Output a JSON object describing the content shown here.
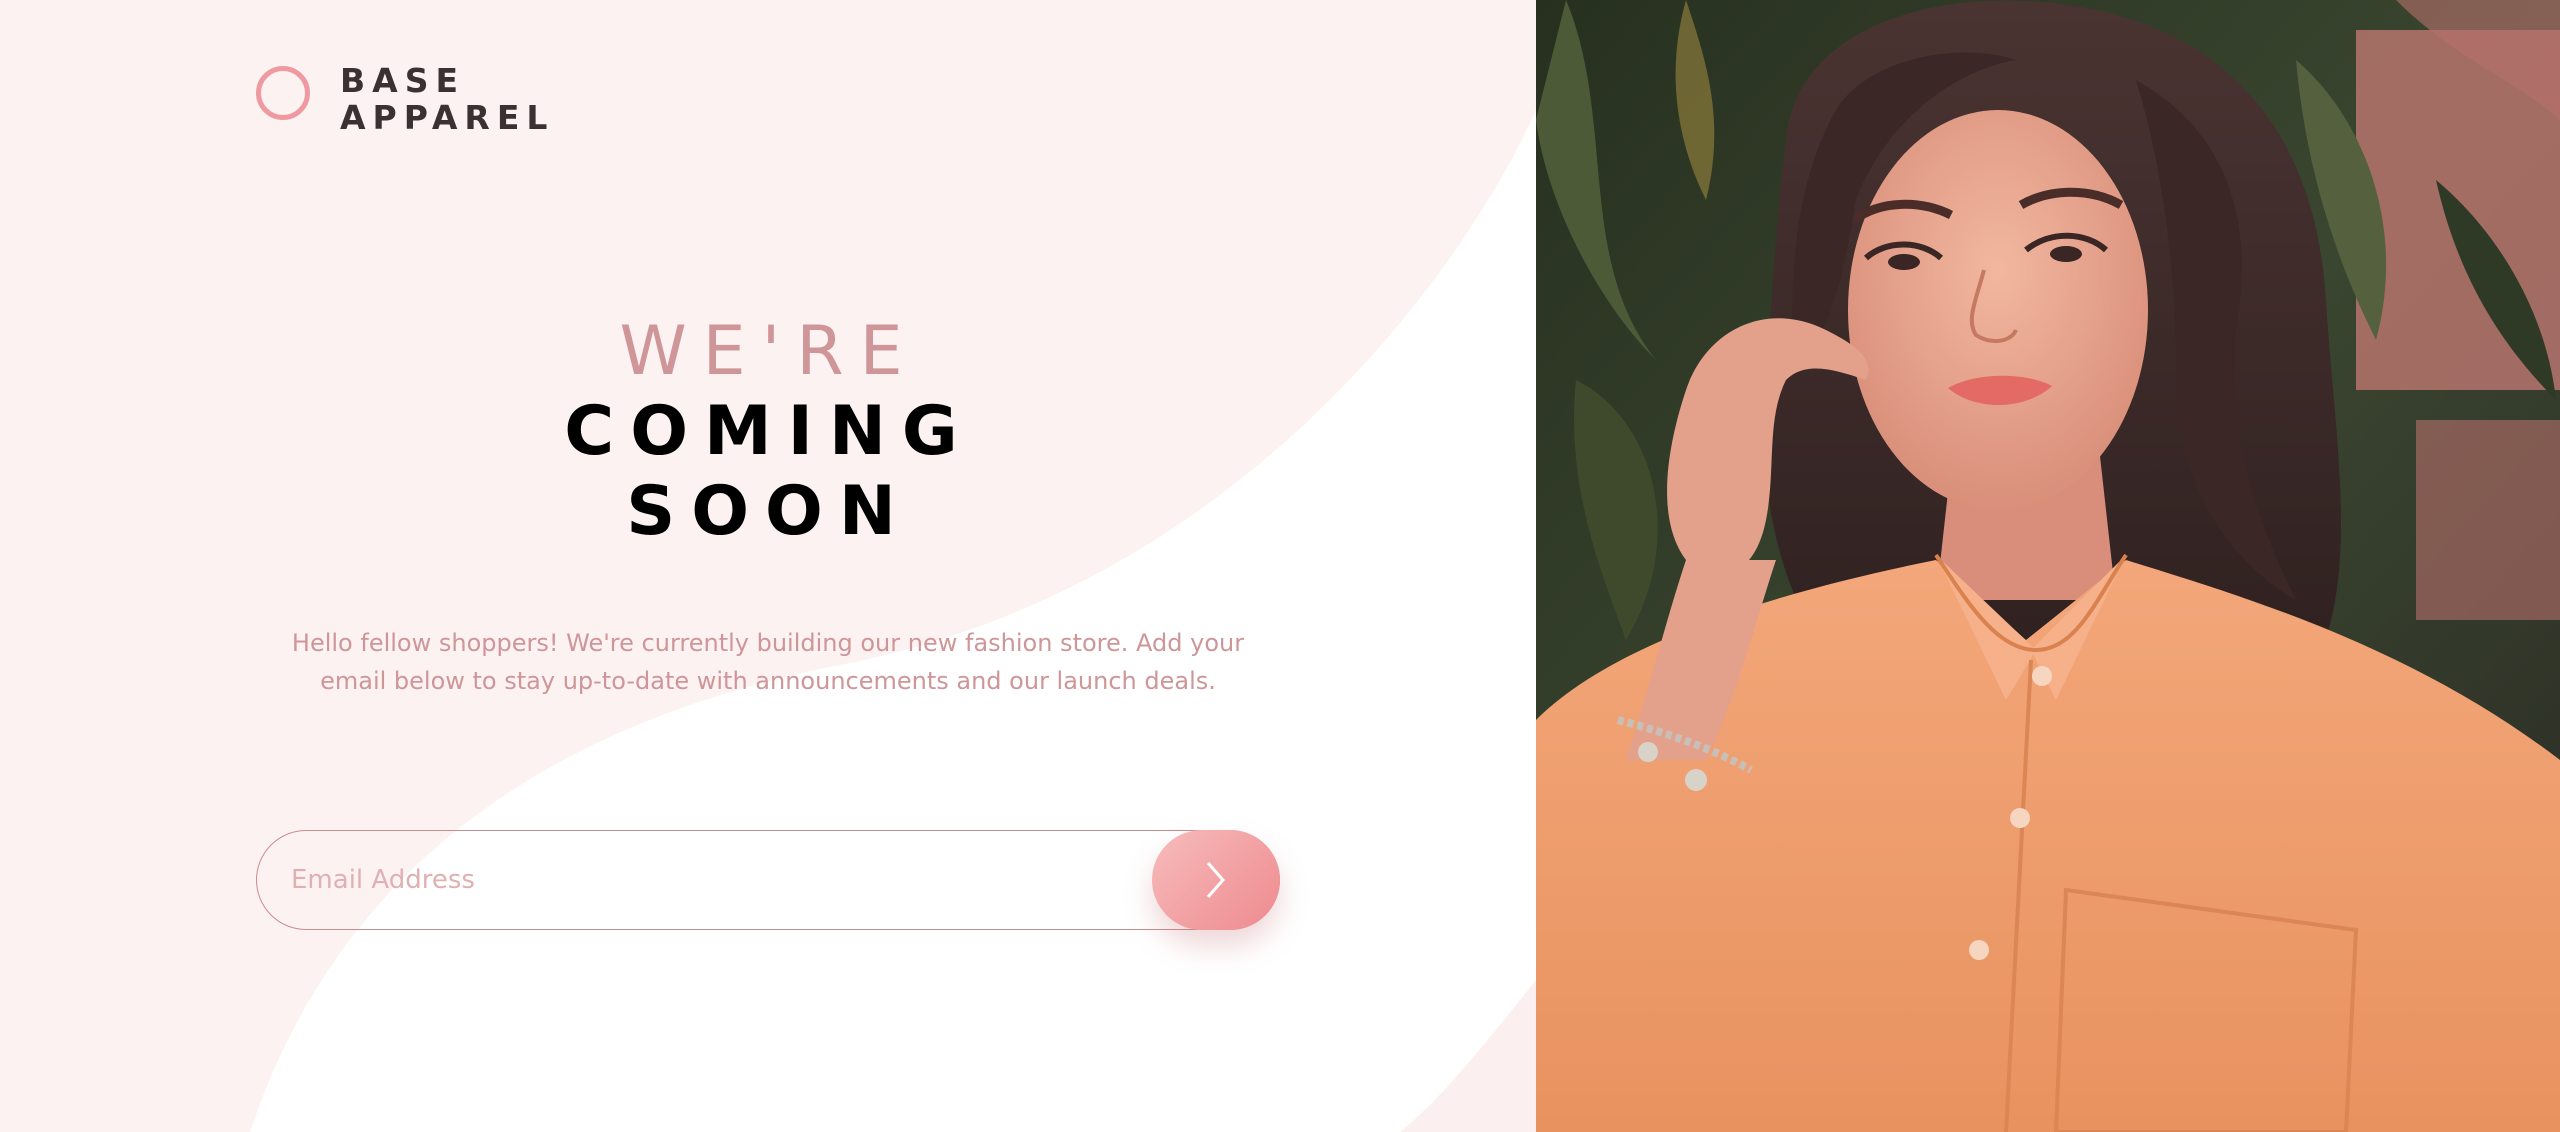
{
  "brand": {
    "name_line1": "BASE",
    "name_line2": "APPAREL"
  },
  "headline": {
    "line1": "WE'RE",
    "line2": "COMING",
    "line3": "SOON"
  },
  "description": "Hello fellow shoppers! We're currently building our new fashion store. Add your email below to stay up-to-date with announcements and our launch deals.",
  "signup": {
    "email_placeholder": "Email Address",
    "email_value": "",
    "submit_icon": "chevron-right-icon"
  },
  "hero_image": {
    "subject": "woman-in-peach-shirt-photo"
  },
  "colors": {
    "accent": "#ef9aa0",
    "text_muted": "#ce9698",
    "text_dark": "#3b3133",
    "background": "#fdf4f4",
    "button_gradient_start": "#f7bcbc",
    "button_gradient_end": "#ee8a8e"
  }
}
